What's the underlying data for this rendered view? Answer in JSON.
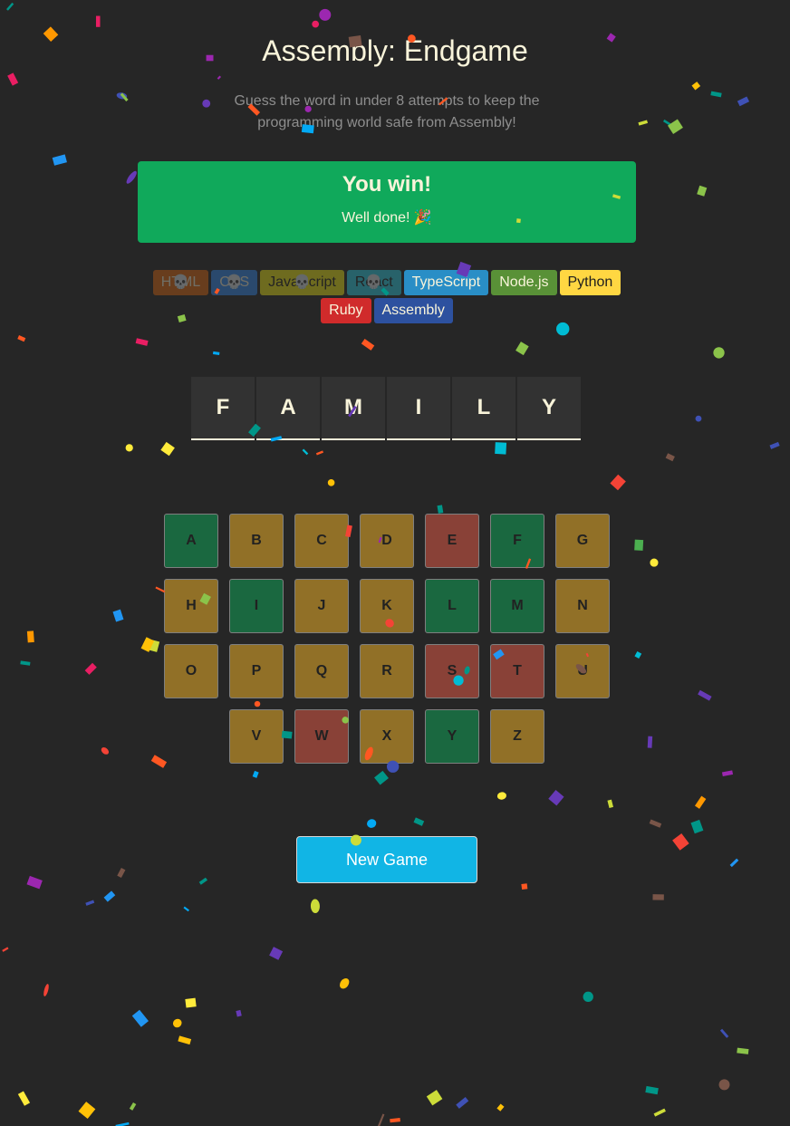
{
  "header": {
    "title": "Assembly: Endgame",
    "subtitle": "Guess the word in under 8 attempts to keep the programming world safe from Assembly!"
  },
  "status": {
    "title": "You win!",
    "message": "Well done! 🎉",
    "color": "#10A95B"
  },
  "languages": [
    {
      "name": "HTML",
      "bg": "#E2680F",
      "fg": "#F9F4DA",
      "lost": true
    },
    {
      "name": "CSS",
      "bg": "#328AF1",
      "fg": "#F9F4DA",
      "lost": true
    },
    {
      "name": "JavaScript",
      "bg": "#F4EB13",
      "fg": "#1E1E1E",
      "lost": true
    },
    {
      "name": "React",
      "bg": "#2ED3E9",
      "fg": "#1E1E1E",
      "lost": true
    },
    {
      "name": "TypeScript",
      "bg": "#298EC6",
      "fg": "#F9F4DA",
      "lost": false
    },
    {
      "name": "Node.js",
      "bg": "#599137",
      "fg": "#F9F4DA",
      "lost": false
    },
    {
      "name": "Python",
      "bg": "#FFD742",
      "fg": "#1E1E1E",
      "lost": false
    },
    {
      "name": "Ruby",
      "bg": "#D02B2B",
      "fg": "#F9F4DA",
      "lost": false
    },
    {
      "name": "Assembly",
      "bg": "#2D519F",
      "fg": "#F9F4DA",
      "lost": false
    }
  ],
  "word": [
    "F",
    "A",
    "M",
    "I",
    "L",
    "Y"
  ],
  "keyboard": [
    {
      "letter": "A",
      "state": "correct"
    },
    {
      "letter": "B",
      "state": "neutral"
    },
    {
      "letter": "C",
      "state": "neutral"
    },
    {
      "letter": "D",
      "state": "neutral"
    },
    {
      "letter": "E",
      "state": "wrong"
    },
    {
      "letter": "F",
      "state": "correct"
    },
    {
      "letter": "G",
      "state": "neutral"
    },
    {
      "letter": "H",
      "state": "neutral"
    },
    {
      "letter": "I",
      "state": "correct"
    },
    {
      "letter": "J",
      "state": "neutral"
    },
    {
      "letter": "K",
      "state": "neutral"
    },
    {
      "letter": "L",
      "state": "correct"
    },
    {
      "letter": "M",
      "state": "correct"
    },
    {
      "letter": "N",
      "state": "neutral"
    },
    {
      "letter": "O",
      "state": "neutral"
    },
    {
      "letter": "P",
      "state": "neutral"
    },
    {
      "letter": "Q",
      "state": "neutral"
    },
    {
      "letter": "R",
      "state": "neutral"
    },
    {
      "letter": "S",
      "state": "wrong"
    },
    {
      "letter": "T",
      "state": "wrong"
    },
    {
      "letter": "U",
      "state": "neutral"
    },
    {
      "letter": "V",
      "state": "neutral"
    },
    {
      "letter": "W",
      "state": "wrong"
    },
    {
      "letter": "X",
      "state": "neutral"
    },
    {
      "letter": "Y",
      "state": "correct"
    },
    {
      "letter": "Z",
      "state": "neutral"
    }
  ],
  "new_game_label": "New Game",
  "confetti_colors": [
    "#F44336",
    "#E91E63",
    "#9C27B0",
    "#673AB7",
    "#3F51B5",
    "#2196F3",
    "#03A9F4",
    "#00BCD4",
    "#009688",
    "#4CAF50",
    "#8BC34A",
    "#CDDC39",
    "#FFEB3B",
    "#FFC107",
    "#FF9800",
    "#FF5722",
    "#795548"
  ]
}
